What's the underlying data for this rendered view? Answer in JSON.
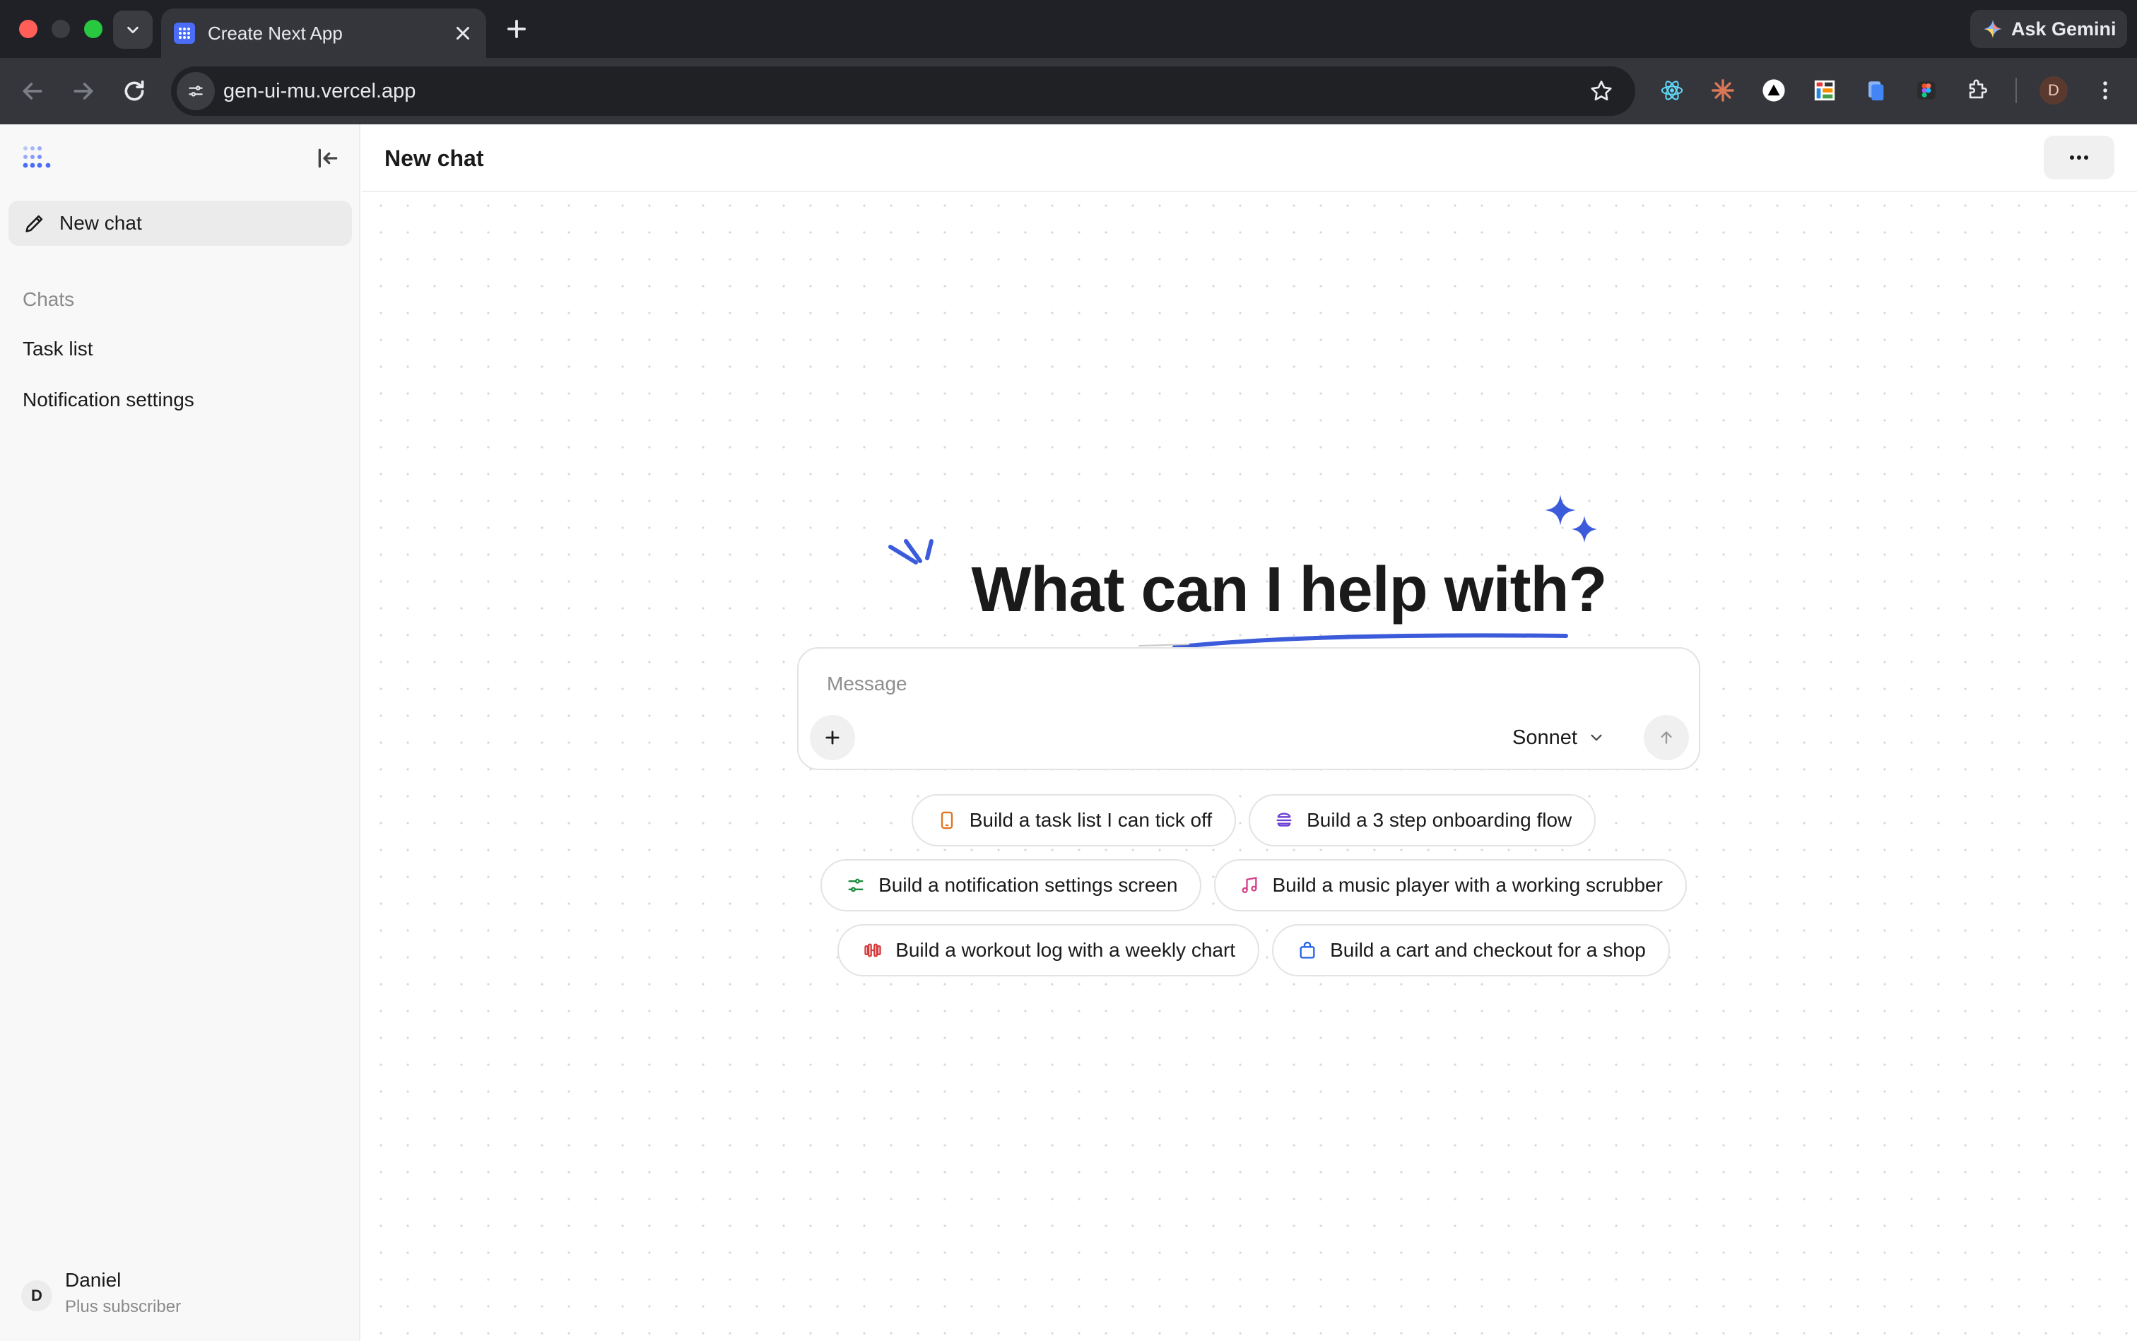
{
  "browser": {
    "tab_title": "Create Next App",
    "url": "gen-ui-mu.vercel.app",
    "ask_gemini_label": "Ask Gemini",
    "profile_initial": "D"
  },
  "sidebar": {
    "new_chat_label": "New chat",
    "section_label": "Chats",
    "chats": [
      {
        "label": "Task list"
      },
      {
        "label": "Notification settings"
      }
    ],
    "user": {
      "initial": "D",
      "name": "Daniel",
      "plan": "Plus subscriber"
    }
  },
  "main": {
    "title": "New chat",
    "headline": "What can I help with?",
    "composer": {
      "placeholder": "Message",
      "model": "Sonnet"
    },
    "suggestions": [
      {
        "label": "Build a task list I can tick off",
        "icon": "phone-icon",
        "color": "#e0731f"
      },
      {
        "label": "Build a 3 step onboarding flow",
        "icon": "layers-icon",
        "color": "#6d3fd6"
      },
      {
        "label": "Build a notification settings screen",
        "icon": "sliders-icon",
        "color": "#1a8a3c"
      },
      {
        "label": "Build a music player with a working scrubber",
        "icon": "music-note-icon",
        "color": "#d6408a"
      },
      {
        "label": "Build a workout log with a weekly chart",
        "icon": "dumbbell-icon",
        "color": "#d83a3a"
      },
      {
        "label": "Build a cart and checkout for a shop",
        "icon": "shopping-bag-icon",
        "color": "#2563eb"
      }
    ]
  },
  "colors": {
    "accent_blue": "#3b5bdb",
    "sidebar_bg": "#f8f8f8",
    "chrome_dark": "#1f2127"
  }
}
